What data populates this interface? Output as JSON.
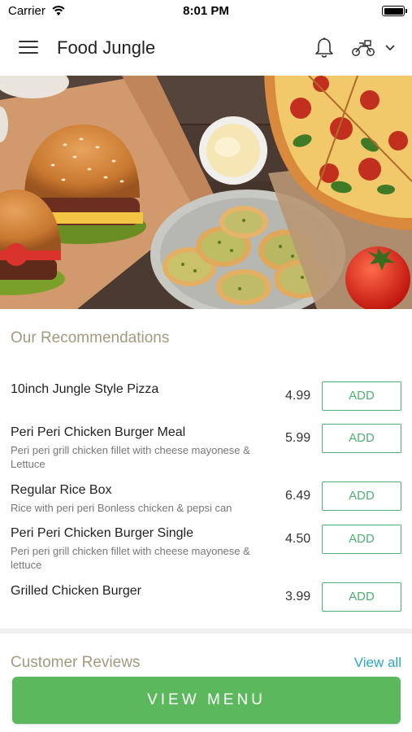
{
  "status_bar": {
    "carrier": "Carrier",
    "time": "8:01 PM"
  },
  "header": {
    "title": "Food Jungle",
    "icons": [
      "menu-icon",
      "bell-icon",
      "delivery-icon",
      "chevron-down-icon"
    ]
  },
  "recommendations": {
    "title": "Our Recommendations",
    "add_label": "ADD",
    "items": [
      {
        "name": "10inch Jungle Style Pizza",
        "description": "",
        "price": "4.99"
      },
      {
        "name": "Peri Peri Chicken Burger Meal",
        "description": "Peri peri grill chicken fillet with cheese mayonese & Lettuce",
        "price": "5.99"
      },
      {
        "name": "Regular Rice Box",
        "description": "Rice with peri peri  Bonless chicken & pepsi can",
        "price": "6.49"
      },
      {
        "name": "Peri Peri Chicken Burger Single",
        "description": "Peri peri grill chicken fillet with cheese mayonese & lettuce",
        "price": "4.50"
      },
      {
        "name": "Grilled Chicken Burger",
        "description": "",
        "price": "3.99"
      }
    ]
  },
  "reviews": {
    "title": "Customer Reviews",
    "view_all": "View all"
  },
  "footer": {
    "view_menu": "VIEW MENU"
  },
  "colors": {
    "accent_green": "#5cb85c",
    "add_border": "#4caf73",
    "section_title": "#a39a7e",
    "link": "#2aa6c5"
  }
}
